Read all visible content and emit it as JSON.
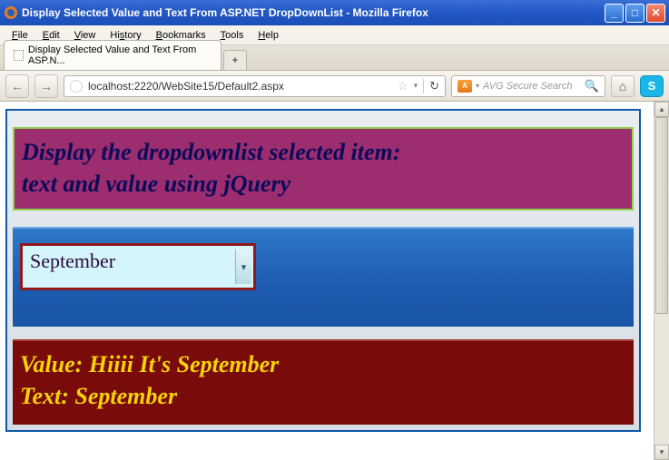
{
  "window": {
    "title": "Display Selected Value and Text From ASP.NET DropDownList - Mozilla Firefox"
  },
  "menu": {
    "file": "File",
    "edit": "Edit",
    "view": "View",
    "history": "History",
    "bookmarks": "Bookmarks",
    "tools": "Tools",
    "help": "Help"
  },
  "tab": {
    "label": "Display Selected Value and Text From ASP.N...",
    "newtab": "+"
  },
  "nav": {
    "url": "localhost:2220/WebSite15/Default2.aspx",
    "search_placeholder": "AVG Secure Search",
    "avg_label": "AVG"
  },
  "page": {
    "heading_line1": "Display the dropdownlist selected item:",
    "heading_line2": "text and value using jQuery",
    "dropdown_selected": "September",
    "result_value": "Value: Hiiii It's September",
    "result_text": "Text: September"
  }
}
